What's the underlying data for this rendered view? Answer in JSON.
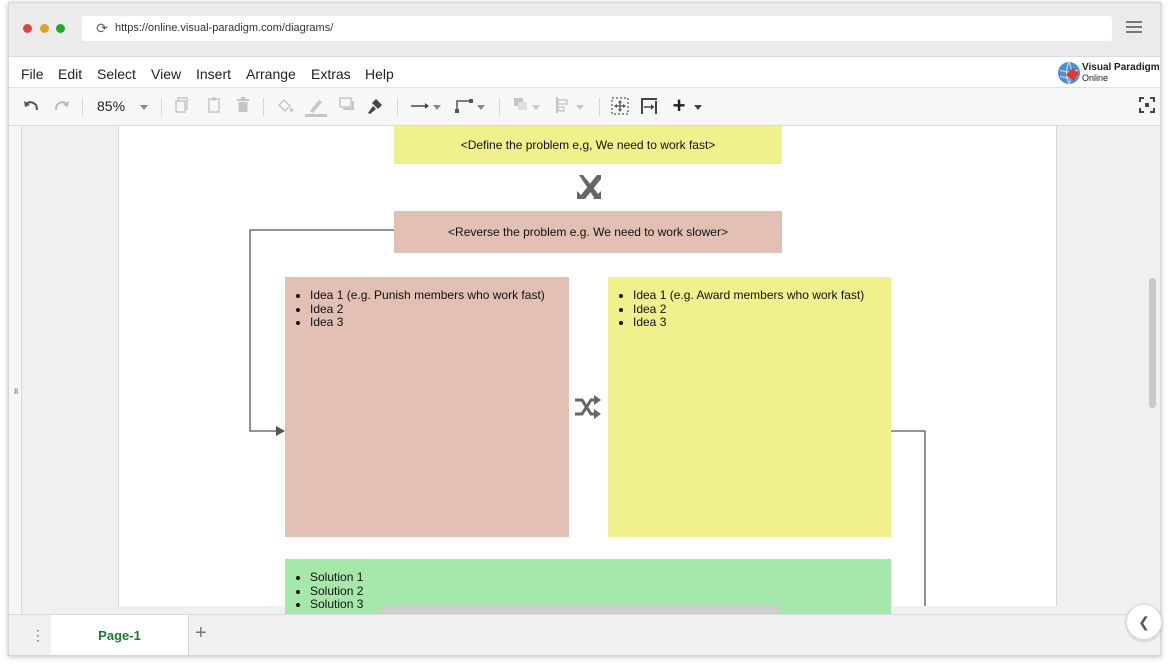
{
  "browser": {
    "url": "https://online.visual-paradigm.com/diagrams/",
    "dot_colors": [
      "#e0443e",
      "#dea123",
      "#1aab29"
    ]
  },
  "menu": {
    "items": [
      "File",
      "Edit",
      "Select",
      "View",
      "Insert",
      "Arrange",
      "Extras",
      "Help"
    ]
  },
  "logo": {
    "line1": "Visual Paradigm",
    "line2": "Online"
  },
  "toolbar": {
    "zoom": "85%"
  },
  "diagram": {
    "problem": "<Define the problem e,g, We need to work fast>",
    "reverse": "<Reverse the problem e.g. We need to work slower>",
    "left_ideas": [
      "Idea 1 (e.g. Punish members who work fast)",
      "Idea 2",
      "Idea 3"
    ],
    "right_ideas": [
      "Idea 1 (e.g. Award members who work fast)",
      "Idea 2",
      "Idea 3"
    ],
    "solutions": [
      "Solution 1",
      "Solution 2",
      "Solution 3"
    ],
    "colors": {
      "yellow": "#f0f08d",
      "pink": "#e2c0b4",
      "green": "#a6e8ac",
      "line": "#555555",
      "icon": "#666666"
    }
  },
  "pages": {
    "tabs": [
      "Page-1"
    ]
  }
}
